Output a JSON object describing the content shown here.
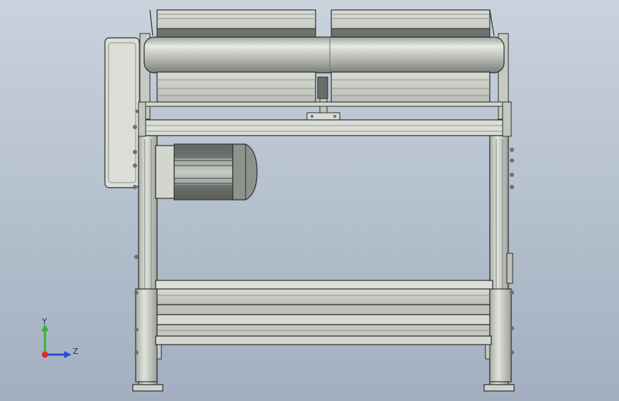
{
  "viewport": {
    "colors": {
      "bg_top": "#c9d2dd",
      "bg_bottom": "#a3afc0",
      "metal": "#c9ccc4",
      "metal_dark": "#6e726d",
      "metal_light": "#e4e6e0",
      "edge": "#2a2d2c",
      "motor_dark": "#4b4f4d"
    }
  },
  "triad": {
    "y_label": "Y",
    "z_label": "Z",
    "x_color": "#d92b2b",
    "y_color": "#2fb82f",
    "z_color": "#2a4fd8"
  }
}
